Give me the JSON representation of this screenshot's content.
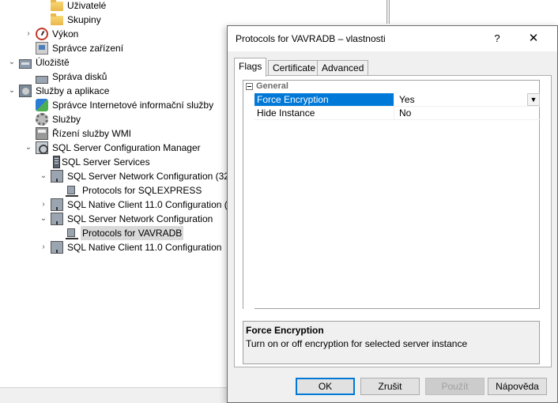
{
  "tree": {
    "items": [
      {
        "label": "Uživatelé",
        "icon": "folder-icon"
      },
      {
        "label": "Skupiny",
        "icon": "folder-icon"
      },
      {
        "label": "Výkon",
        "icon": "performance-icon",
        "expander": "›"
      },
      {
        "label": "Správce zařízení",
        "icon": "device-manager-icon"
      },
      {
        "label": "Úložiště",
        "icon": "storage-icon",
        "expander": "⌄"
      },
      {
        "label": "Správa disků",
        "icon": "disk-icon"
      },
      {
        "label": "Služby a aplikace",
        "icon": "services-apps-icon",
        "expander": "⌄"
      },
      {
        "label": "Správce Internetové informační služby",
        "icon": "iis-icon"
      },
      {
        "label": "Služby",
        "icon": "gear-icon"
      },
      {
        "label": "Řízení služby WMI",
        "icon": "wmi-icon"
      },
      {
        "label": "SQL Server Configuration Manager",
        "icon": "sql-config-manager-icon",
        "expander": "⌄"
      },
      {
        "label": "SQL Server Services",
        "icon": "server-icon"
      },
      {
        "label": "SQL Server Network Configuration (32",
        "icon": "network-config-icon",
        "expander": "⌄"
      },
      {
        "label": "Protocols for SQLEXPRESS",
        "icon": "protocols-icon"
      },
      {
        "label": "SQL Native Client 11.0 Configuration (3",
        "icon": "native-client-icon",
        "expander": "›"
      },
      {
        "label": "SQL Server Network Configuration",
        "icon": "network-config-icon",
        "expander": "⌄"
      },
      {
        "label": "Protocols for VAVRADB",
        "icon": "protocols-icon",
        "selected": true
      },
      {
        "label": "SQL Native Client 11.0 Configuration",
        "icon": "native-client-icon",
        "expander": "›"
      }
    ]
  },
  "dialog": {
    "title": "Protocols for VAVRADB – vlastnosti",
    "help_glyph": "?",
    "close_glyph": "✕",
    "tabs": [
      {
        "label": "Flags",
        "active": true
      },
      {
        "label": "Certificate",
        "active": false
      },
      {
        "label": "Advanced",
        "active": false
      }
    ],
    "grid": {
      "category": "General",
      "rows": [
        {
          "name": "Force Encryption",
          "value": "Yes",
          "selected": true
        },
        {
          "name": "Hide Instance",
          "value": "No",
          "selected": false
        }
      ],
      "dropdown_glyph": "▼"
    },
    "description": {
      "title": "Force Encryption",
      "text": "Turn on or off encryption for selected server instance"
    },
    "buttons": {
      "ok": "OK",
      "cancel": "Zrušit",
      "apply": "Použít",
      "help": "Nápověda"
    }
  },
  "colors": {
    "selection": "#0078d7",
    "tree_selected": "#d9d9d9",
    "dialog_bg": "#f0f0f0"
  }
}
